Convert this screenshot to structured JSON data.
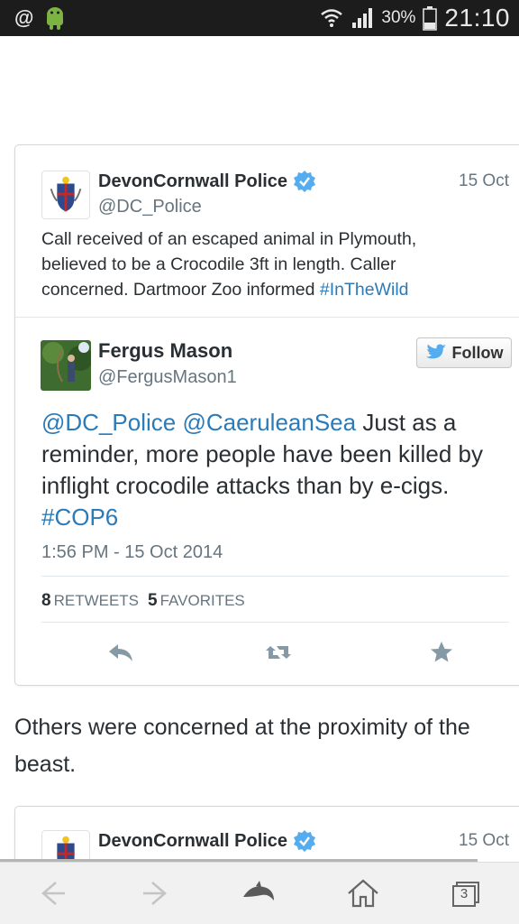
{
  "status_bar": {
    "battery_percent": "30%",
    "time": "21:10",
    "icons": [
      "at-icon",
      "android-icon",
      "wifi-icon",
      "signal-icon",
      "battery-icon"
    ]
  },
  "quoted_tweet": {
    "name": "DevonCornwall Police",
    "handle": "@DC_Police",
    "date": "15 Oct",
    "text": "Call received of an escaped animal in Plymouth, believed to be a Crocodile 3ft in length. Caller concerned. Dartmoor Zoo informed ",
    "hashtag": "#InTheWild"
  },
  "main_tweet": {
    "name": "Fergus Mason",
    "handle": "@FergusMason1",
    "follow_label": "Follow",
    "mention1": "@DC_Police",
    "mention2": "@CaeruleanSea",
    "text": " Just as a reminder, more people have been killed by inflight crocodile attacks than by e-cigs. ",
    "hashtag": "#COP6",
    "timestamp": "1:56 PM - 15 Oct 2014",
    "retweets_count": "8",
    "retweets_label": "RETWEETS",
    "favorites_count": "5",
    "favorites_label": "FAVORITES"
  },
  "article": {
    "paragraph": "Others were concerned at the proximity of the beast."
  },
  "next_tweet": {
    "name": "DevonCornwall Police",
    "date": "15 Oct"
  },
  "browser_bar": {
    "tab_count": "3"
  },
  "colors": {
    "link_blue": "#2b7bb9",
    "verified_blue": "#55acee",
    "text_dark": "#292f33",
    "text_gray": "#66757f"
  }
}
